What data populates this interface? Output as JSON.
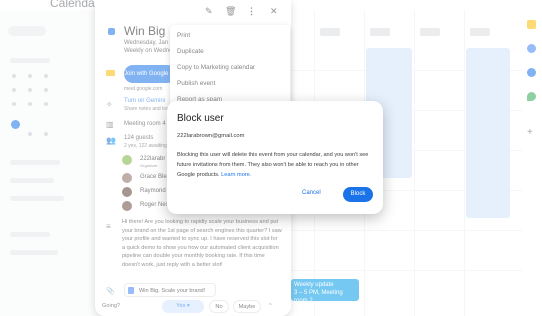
{
  "app": {
    "title": "Calendar"
  },
  "background_event": {
    "title": "Weekly update",
    "time": "3 – 5 PM, Meeting room 2"
  },
  "event": {
    "title": "Win Big",
    "date": "Wednesday, Jan",
    "recurrence": "Weekly on Wednesd",
    "join_label": "Join with Google Meet",
    "meet_link": "meet.google.com",
    "gemini_label": "Turn on Gemini",
    "gemini_sub": "Share notes and tran",
    "room": "Meeting room 4",
    "guests_count": "124 guests",
    "guests_sub": "2 yes, 122 awaiting",
    "guests": [
      {
        "name": "222larabr",
        "sub": "Organizer",
        "color": "#7cb342"
      },
      {
        "name": "Grace Blee",
        "sub": "",
        "color": "#8d6e63"
      },
      {
        "name": "Raymond",
        "sub": "",
        "color": "#5d4037"
      },
      {
        "name": "Roger Nes",
        "sub": "",
        "color": "#6d4c41"
      }
    ],
    "description": "Hi there! Are you looking to rapidly scale your business and put your brand on the 1st page of search engines this quarter? I saw your profile and wanted to sync up. I have reserved this slot for a quick demo to show you how our automated client acquisition pipeline can double your monthly booking rate. If this time doesn't work, just reply with a better slot!",
    "attachment": "Win Big. Scale your brand!",
    "rsvp": {
      "going": "Going?",
      "yes": "Yes",
      "no": "No",
      "maybe": "Maybe"
    }
  },
  "menu": {
    "items": [
      "Print",
      "Duplicate",
      "Copy to Marketing calendar",
      "Publish event",
      "Report as spam"
    ]
  },
  "dialog": {
    "title": "Block user",
    "email": "222larabrown@gmail.com",
    "body": "Blocking this user will delete this event from your calendar, and you won't see future invitations from them. They also won't be able to reach you in other Google products.",
    "learn_more": "Learn more.",
    "cancel_label": "Cancel",
    "block_label": "Block"
  },
  "colors": {
    "accent": "#1a73e8",
    "event_chip": "#039be5"
  }
}
